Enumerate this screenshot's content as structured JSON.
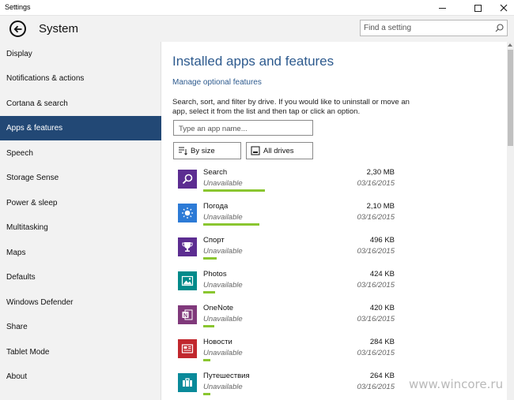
{
  "window": {
    "title": "Settings"
  },
  "header": {
    "page_title": "System",
    "search_placeholder": "Find a setting"
  },
  "sidebar": {
    "items": [
      {
        "label": "Display",
        "active": false
      },
      {
        "label": "Notifications & actions",
        "active": false
      },
      {
        "label": "Cortana & search",
        "active": false
      },
      {
        "label": "Apps & features",
        "active": true
      },
      {
        "label": "Speech",
        "active": false
      },
      {
        "label": "Storage Sense",
        "active": false
      },
      {
        "label": "Power & sleep",
        "active": false
      },
      {
        "label": "Multitasking",
        "active": false
      },
      {
        "label": "Maps",
        "active": false
      },
      {
        "label": "Defaults",
        "active": false
      },
      {
        "label": "Windows Defender",
        "active": false
      },
      {
        "label": "Share",
        "active": false
      },
      {
        "label": "Tablet Mode",
        "active": false
      },
      {
        "label": "About",
        "active": false
      }
    ]
  },
  "main": {
    "heading": "Installed apps and features",
    "manage_link": "Manage optional features",
    "description": "Search, sort, and filter by drive. If you would like to uninstall or move an app, select it from the list and then tap or click an option.",
    "filter_placeholder": "Type an app name...",
    "sort_label": "By size",
    "drive_label": "All drives",
    "apps": [
      {
        "name": "Search",
        "status": "Unavailable",
        "size": "2,30 MB",
        "date": "03/16/2015",
        "icon": "search-icon",
        "tile_color": "#5c2d91",
        "bar_fraction": 1.0
      },
      {
        "name": "Погода",
        "status": "Unavailable",
        "size": "2,10 MB",
        "date": "03/16/2015",
        "icon": "sun-icon",
        "tile_color": "#2d7bd6",
        "bar_fraction": 0.91
      },
      {
        "name": "Спорт",
        "status": "Unavailable",
        "size": "496 KB",
        "date": "03/16/2015",
        "icon": "trophy-icon",
        "tile_color": "#5c2d91",
        "bar_fraction": 0.22
      },
      {
        "name": "Photos",
        "status": "Unavailable",
        "size": "424 KB",
        "date": "03/16/2015",
        "icon": "photo-icon",
        "tile_color": "#008a8a",
        "bar_fraction": 0.19
      },
      {
        "name": "OneNote",
        "status": "Unavailable",
        "size": "420 KB",
        "date": "03/16/2015",
        "icon": "onenote-icon",
        "tile_color": "#80397b",
        "bar_fraction": 0.18
      },
      {
        "name": "Новости",
        "status": "Unavailable",
        "size": "284 KB",
        "date": "03/16/2015",
        "icon": "news-icon",
        "tile_color": "#c1272d",
        "bar_fraction": 0.12
      },
      {
        "name": "Путешествия",
        "status": "Unavailable",
        "size": "264 KB",
        "date": "03/16/2015",
        "icon": "travel-icon",
        "tile_color": "#0a8a9a",
        "bar_fraction": 0.11
      }
    ]
  },
  "watermark": "www.wincore.ru"
}
